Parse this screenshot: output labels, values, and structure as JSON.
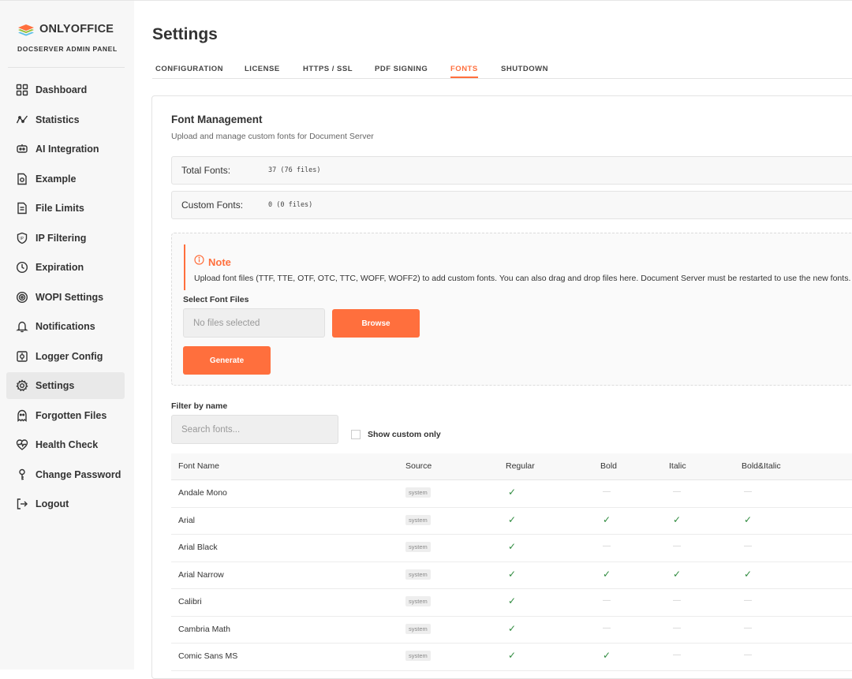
{
  "brand": {
    "name": "ONLYOFFICE",
    "subtitle": "DOCSERVER ADMIN PANEL"
  },
  "nav": [
    {
      "label": "Dashboard",
      "icon": "dashboard-icon",
      "active": false
    },
    {
      "label": "Statistics",
      "icon": "statistics-icon",
      "active": false
    },
    {
      "label": "AI Integration",
      "icon": "ai-robot-icon",
      "active": false
    },
    {
      "label": "Example",
      "icon": "example-doc-icon",
      "active": false
    },
    {
      "label": "File Limits",
      "icon": "file-limits-icon",
      "active": false
    },
    {
      "label": "IP Filtering",
      "icon": "ip-shield-icon",
      "active": false
    },
    {
      "label": "Expiration",
      "icon": "clock-icon",
      "active": false
    },
    {
      "label": "WOPI Settings",
      "icon": "wopi-gear-icon",
      "active": false
    },
    {
      "label": "Notifications",
      "icon": "bell-icon",
      "active": false
    },
    {
      "label": "Logger Config",
      "icon": "logger-icon",
      "active": false
    },
    {
      "label": "Settings",
      "icon": "gear-icon",
      "active": true
    },
    {
      "label": "Forgotten Files",
      "icon": "ghost-icon",
      "active": false
    },
    {
      "label": "Health Check",
      "icon": "heart-pulse-icon",
      "active": false
    },
    {
      "label": "Change Password",
      "icon": "key-icon",
      "active": false
    },
    {
      "label": "Logout",
      "icon": "logout-icon",
      "active": false
    }
  ],
  "page": {
    "title": "Settings"
  },
  "tabs": [
    {
      "label": "CONFIGURATION",
      "active": false
    },
    {
      "label": "LICENSE",
      "active": false
    },
    {
      "label": "HTTPS / SSL",
      "active": false
    },
    {
      "label": "PDF SIGNING",
      "active": false
    },
    {
      "label": "FONTS",
      "active": true
    },
    {
      "label": "SHUTDOWN",
      "active": false
    }
  ],
  "fonts": {
    "title": "Font Management",
    "subtitle": "Upload and manage custom fonts for Document Server",
    "total_label": "Total Fonts:",
    "total_value": "37 (76 files)",
    "custom_label": "Custom Fonts:",
    "custom_value": "0 (0 files)",
    "note_title": "Note",
    "note_text": "Upload font files (TTF, TTE, OTF, OTC, TTC, WOFF, WOFF2) to add custom fonts. You can also drag and drop files here. Document Server must be restarted to use the new fonts.",
    "select_label": "Select Font Files",
    "file_placeholder": "No files selected",
    "browse_label": "Browse",
    "generate_label": "Generate",
    "filter_label": "Filter by name",
    "search_placeholder": "Search fonts...",
    "show_custom_label": "Show custom only",
    "show_custom_checked": false
  },
  "table": {
    "headers": [
      "Font Name",
      "Source",
      "Regular",
      "Bold",
      "Italic",
      "Bold&Italic"
    ],
    "check_mark": "✓",
    "dash": "—",
    "rows": [
      {
        "name": "Andale Mono",
        "source": "system",
        "regular": true,
        "bold": false,
        "italic": false,
        "bold_italic": false
      },
      {
        "name": "Arial",
        "source": "system",
        "regular": true,
        "bold": true,
        "italic": true,
        "bold_italic": true
      },
      {
        "name": "Arial Black",
        "source": "system",
        "regular": true,
        "bold": false,
        "italic": false,
        "bold_italic": false
      },
      {
        "name": "Arial Narrow",
        "source": "system",
        "regular": true,
        "bold": true,
        "italic": true,
        "bold_italic": true
      },
      {
        "name": "Calibri",
        "source": "system",
        "regular": true,
        "bold": false,
        "italic": false,
        "bold_italic": false
      },
      {
        "name": "Cambria Math",
        "source": "system",
        "regular": true,
        "bold": false,
        "italic": false,
        "bold_italic": false
      },
      {
        "name": "Comic Sans MS",
        "source": "system",
        "regular": true,
        "bold": true,
        "italic": false,
        "bold_italic": false
      }
    ]
  },
  "colors": {
    "accent": "#ff6f3d",
    "check": "#2e8b3e",
    "sidebar_bg": "#f7f7f7"
  }
}
